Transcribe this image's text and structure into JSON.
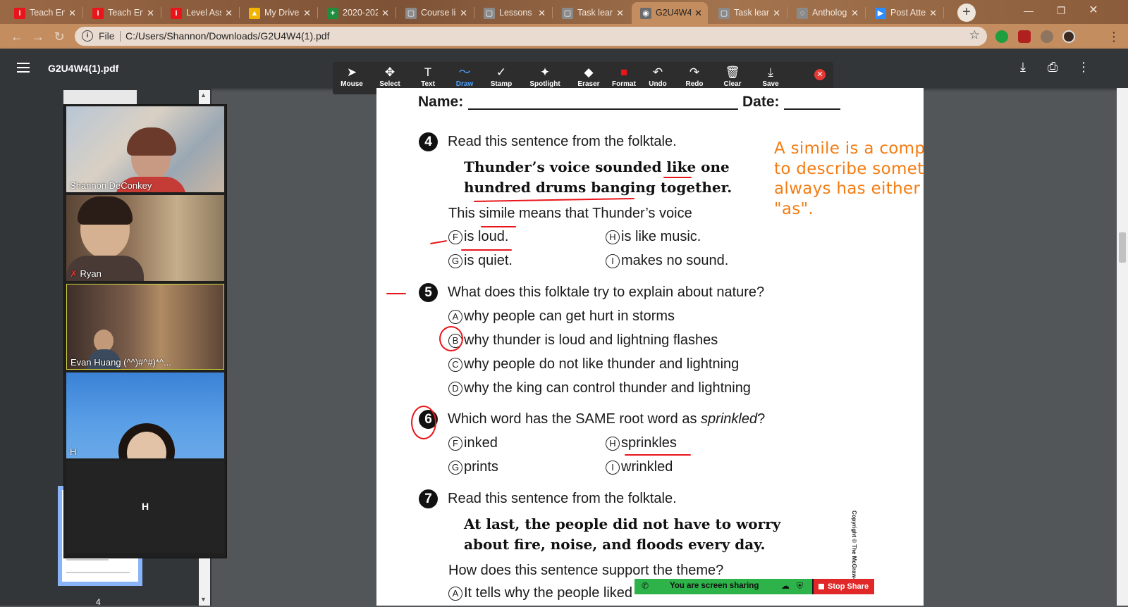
{
  "tabs": [
    {
      "label": "Teach En",
      "icon": "i",
      "color": "#e8161b"
    },
    {
      "label": "Teach En",
      "icon": "i",
      "color": "#e8161b"
    },
    {
      "label": "Level Ass",
      "icon": "i",
      "color": "#e8161b"
    },
    {
      "label": "My Drive",
      "icon": "▲",
      "color": "#f3b400"
    },
    {
      "label": "2020-202",
      "icon": "+",
      "color": "#1e8e3e"
    },
    {
      "label": "Course lis",
      "icon": "▢",
      "color": "#8a8a8a"
    },
    {
      "label": "Lessons -",
      "icon": "▢",
      "color": "#8a8a8a"
    },
    {
      "label": "Task learn",
      "icon": "▢",
      "color": "#8a8a8a"
    },
    {
      "label": "G2U4W4(",
      "icon": "◉",
      "color": "#6b6b6b",
      "active": true
    },
    {
      "label": "Task learn",
      "icon": "▢",
      "color": "#8a8a8a"
    },
    {
      "label": "Antholog",
      "icon": "◌",
      "color": "#8a8a8a"
    },
    {
      "label": "Post Atte",
      "icon": "▶",
      "color": "#2d8cff"
    }
  ],
  "address": {
    "scheme": "File",
    "url": "C:/Users/Shannon/Downloads/G2U4W4(1).pdf"
  },
  "pdf": {
    "title": "G2U4W4(1).pdf",
    "page_number": "4"
  },
  "tools": [
    {
      "label": "Mouse",
      "icon": "➤"
    },
    {
      "label": "Select",
      "icon": "✥"
    },
    {
      "label": "Text",
      "icon": "T"
    },
    {
      "label": "Draw",
      "icon": "〜",
      "active": true
    },
    {
      "label": "Stamp",
      "icon": "✓"
    },
    {
      "label": "Spotlight",
      "icon": "✦"
    },
    {
      "label": "Eraser",
      "icon": "◆"
    },
    {
      "label": "Format",
      "icon": "■"
    },
    {
      "label": "Undo",
      "icon": "↶"
    },
    {
      "label": "Redo",
      "icon": "↷"
    },
    {
      "label": "Clear",
      "icon": "🗑"
    },
    {
      "label": "Save",
      "icon": "⤓"
    }
  ],
  "participants": {
    "shannon": "Shannon DeConkey",
    "ryan": "Ryan",
    "evan": "Evan Huang (^^)#^#)*^...",
    "h": "H",
    "h_tile": "H"
  },
  "worksheet": {
    "name_label": "Name:",
    "date_label": "Date:",
    "q4": {
      "num": "4",
      "prompt": "Read this sentence from the folktale.",
      "quote_line1": "Thunder’s voice sounded like one",
      "quote_line2": "hundred drums banging together.",
      "stem": "This simile means that Thunder’s voice",
      "options": [
        {
          "letter": "F",
          "text": "is loud."
        },
        {
          "letter": "H",
          "text": "is like music."
        },
        {
          "letter": "G",
          "text": "is quiet."
        },
        {
          "letter": "I",
          "text": "makes no sound."
        }
      ]
    },
    "q5": {
      "num": "5",
      "prompt": "What does this folktale try to explain about nature?",
      "options": [
        {
          "letter": "A",
          "text": "why people can get hurt in storms"
        },
        {
          "letter": "B",
          "text": "why thunder is loud and lightning flashes"
        },
        {
          "letter": "C",
          "text": "why people do not like thunder and lightning"
        },
        {
          "letter": "D",
          "text": "why the king can control thunder and lightning"
        }
      ]
    },
    "q6": {
      "num": "6",
      "prompt_before": "Which word has the SAME root word as ",
      "prompt_italic": "sprinkled",
      "prompt_after": "?",
      "options": [
        {
          "letter": "F",
          "text": "inked"
        },
        {
          "letter": "H",
          "text": "sprinkles"
        },
        {
          "letter": "G",
          "text": "prints"
        },
        {
          "letter": "I",
          "text": "wrinkled"
        }
      ]
    },
    "q7": {
      "num": "7",
      "prompt": "Read this sentence from the folktale.",
      "quote_line1": "At last, the people did not have to worry",
      "quote_line2": "about fire, noise, and floods every day.",
      "stem": "How does this sentence support the theme?",
      "partial_option": "It tells why the people liked"
    },
    "note": "A simile is a comparison used to describe something.  It always has either \"like\" or \"as\".",
    "copyright": "Copyright © The McGraw-Hill"
  },
  "sharing": {
    "status": "You are screen sharing",
    "stop_label": "Stop Share"
  },
  "colors": {
    "annotation_red": "#e8161b",
    "note_orange": "#f47c12",
    "share_green": "#2db34a",
    "stop_red": "#e02828"
  }
}
